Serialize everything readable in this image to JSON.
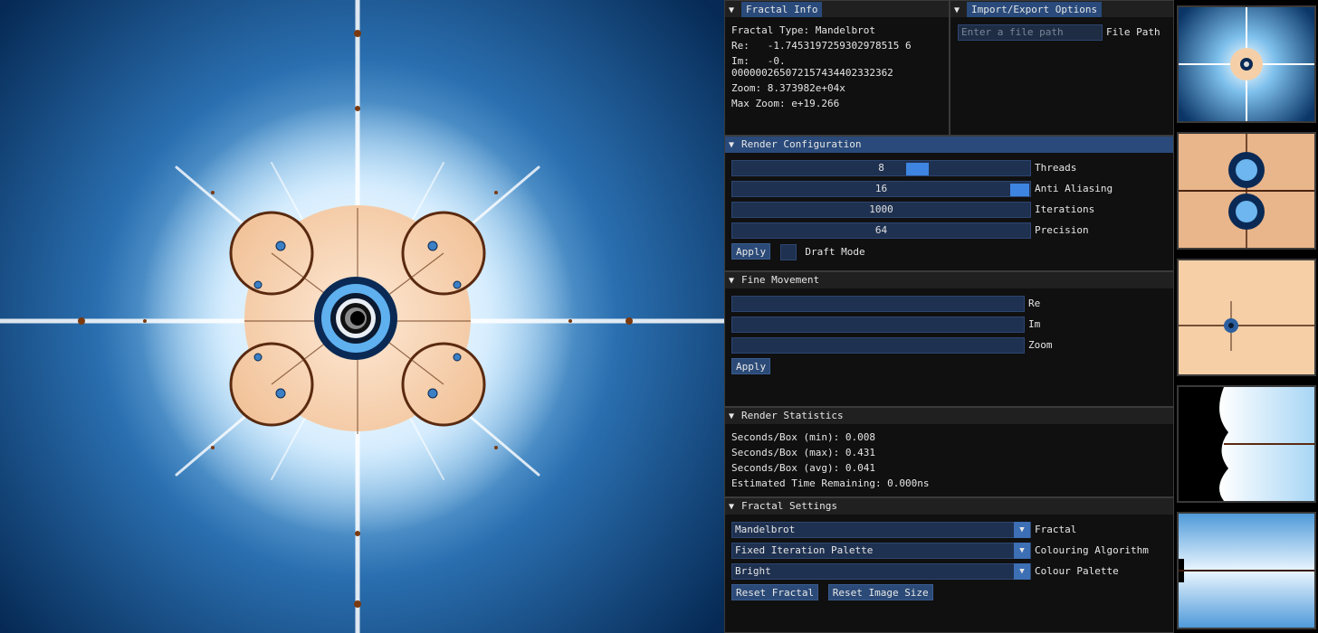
{
  "fractal_info": {
    "title": "Fractal Info",
    "type_line": "Fractal Type: Mandelbrot",
    "re_line": "Re:   -1.7453197259302978515 6",
    "im_line1": "Im:   -0.",
    "im_line2": "000000265072157434402332362",
    "zoom_line": "Zoom: 8.373982e+04x",
    "max_zoom_line": "Max Zoom: e+19.266"
  },
  "import_export": {
    "title": "Import/Export Options",
    "file_path_placeholder": "Enter a file path",
    "file_path_label": "File Path"
  },
  "render_config": {
    "title": "Render Configuration",
    "threads_value": "8",
    "threads_label": "Threads",
    "aa_value": "16",
    "aa_label": "Anti Aliasing",
    "iterations_value": "1000",
    "iterations_label": "Iterations",
    "precision_value": "64",
    "precision_label": "Precision",
    "apply_label": "Apply",
    "draft_label": "Draft Mode"
  },
  "fine_movement": {
    "title": "Fine Movement",
    "re_label": "Re",
    "im_label": "Im",
    "zoom_label": "Zoom",
    "apply_label": "Apply"
  },
  "render_stats": {
    "title": "Render Statistics",
    "min_line": "Seconds/Box (min): 0.008",
    "max_line": "Seconds/Box (max): 0.431",
    "avg_line": "Seconds/Box (avg): 0.041",
    "eta_line": "Estimated Time Remaining: 0.000ns"
  },
  "fractal_settings": {
    "title": "Fractal Settings",
    "fractal_value": "Mandelbrot",
    "fractal_label": "Fractal",
    "colouring_value": "Fixed Iteration Palette",
    "colouring_label": "Colouring Algorithm",
    "palette_value": "Bright",
    "palette_label": "Colour Palette",
    "reset_fractal_label": "Reset Fractal",
    "reset_size_label": "Reset Image Size"
  },
  "colors": {
    "accent": "#3d85e0",
    "title_active": "#294a7a",
    "field_bg": "#1f3150",
    "fractal_deep_blue": "#0b3a6e",
    "fractal_glow": "#eaf6ff",
    "fractal_peach": "#f6d3b0"
  }
}
